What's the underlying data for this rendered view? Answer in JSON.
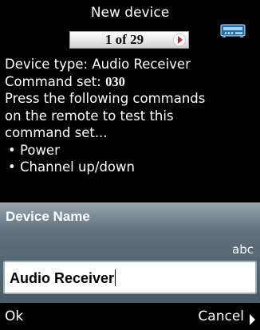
{
  "header": {
    "title": "New device",
    "counter": "1 of 29"
  },
  "info": {
    "device_type": "Device type: Audio Receiver",
    "command_set_label": "Command set: ",
    "command_set_value": "030",
    "instructions_1": "Press the following commands",
    "instructions_2": "on the remote to test this",
    "instructions_3": "command set...",
    "bullets": [
      "Power",
      "Channel up/down"
    ]
  },
  "panel": {
    "title": "Device Name",
    "input_mode": "abc",
    "input_value": "Audio Receiver"
  },
  "softkeys": {
    "left": "Ok",
    "right": "Cancel"
  },
  "icons": {
    "next": "chevron-right-icon",
    "device": "audio-receiver-icon"
  },
  "colors": {
    "next_arrow": "#d2223a",
    "panel": "#5b6a75"
  }
}
